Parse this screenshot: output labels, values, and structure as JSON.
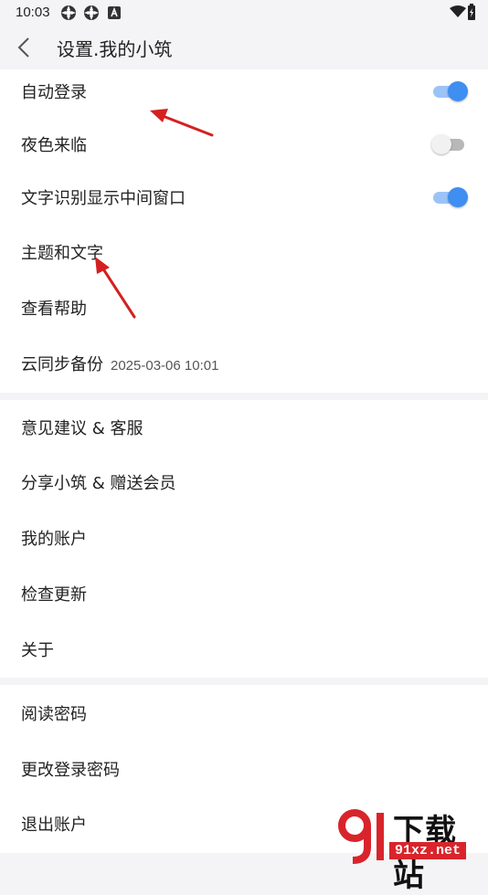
{
  "status_bar": {
    "time": "10:03"
  },
  "header": {
    "title": "设置.我的小筑"
  },
  "group1": [
    {
      "label": "自动登录",
      "toggle": true
    },
    {
      "label": "夜色来临",
      "toggle": false
    },
    {
      "label": "文字识别显示中间窗口",
      "toggle": true
    },
    {
      "label": "主题和文字"
    },
    {
      "label": "查看帮助"
    },
    {
      "label": "云同步备份",
      "sub": "2025-03-06 10:01"
    }
  ],
  "group2": [
    {
      "label": "意见建议 & 客服"
    },
    {
      "label": "分享小筑 & 赠送会员"
    },
    {
      "label": "我的账户"
    },
    {
      "label": "检查更新"
    },
    {
      "label": "关于"
    }
  ],
  "group3": [
    {
      "label": "阅读密码"
    },
    {
      "label": "更改登录密码"
    },
    {
      "label": "退出账户"
    }
  ],
  "watermark": {
    "name": "下载站",
    "url": "91xz.net"
  },
  "colors": {
    "accent": "#3f8ef1",
    "annotation_arrow": "#d42020"
  }
}
